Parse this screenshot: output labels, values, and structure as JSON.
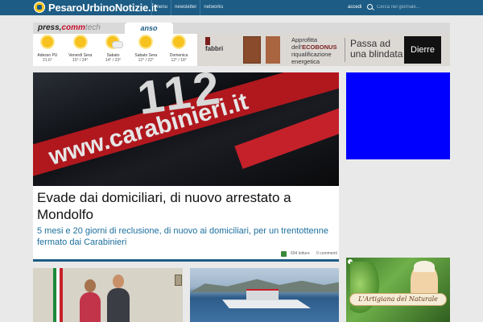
{
  "header": {
    "site_title": "PesaroUrbinoNotizie.it",
    "nav": [
      "menu",
      "newsletter",
      "networks"
    ],
    "login_label": "accedi",
    "search_placeholder": "Cerca nel giornale..."
  },
  "weather_header": {
    "brand_press": "press,",
    "brand_comm": "comm",
    "brand_tech": "tech",
    "tab_label": "anso"
  },
  "weather": [
    {
      "day": "Adesso PU",
      "temp": "21.6°",
      "icon": "sun-icon"
    },
    {
      "day": "Venerdì Sera",
      "temp": "15° / 24°",
      "icon": "sun-icon"
    },
    {
      "day": "Sabato",
      "temp": "14° / 23°",
      "icon": "sun-cloud-icon"
    },
    {
      "day": "Sabato Sera",
      "temp": "12° / 22°",
      "icon": "sun-icon"
    },
    {
      "day": "Domenica",
      "temp": "12° / 18°",
      "icon": "sun-icon"
    }
  ],
  "ad_banner": {
    "brand": "fabbri",
    "line1": "Approfitta",
    "line2_prefix": "dell'",
    "line2_bold": "ECOBONUS",
    "line3": "riqualificazione",
    "line4": "energetica",
    "slogan1": "Passa ad",
    "slogan2": "una blindata",
    "logo": "Dierre"
  },
  "main_article": {
    "image_number": "112",
    "image_brand": "www.carabinieri.it",
    "title": "Evade dai domiciliari, di nuovo arrestato a Mondolfo",
    "summary": "5 mesi e 20 giorni di reclusione, di nuovo ai domiciliari, per un trentottenne fermato dai Carabinieri",
    "likes": "694 letture",
    "comments": "0 commenti"
  },
  "side_ad": {
    "banner_text": "L'Artigiana del Naturale"
  },
  "colors": {
    "topbar": "#1d5c84",
    "summary": "#1d6f9e",
    "blue_ad": "#0000ff"
  }
}
